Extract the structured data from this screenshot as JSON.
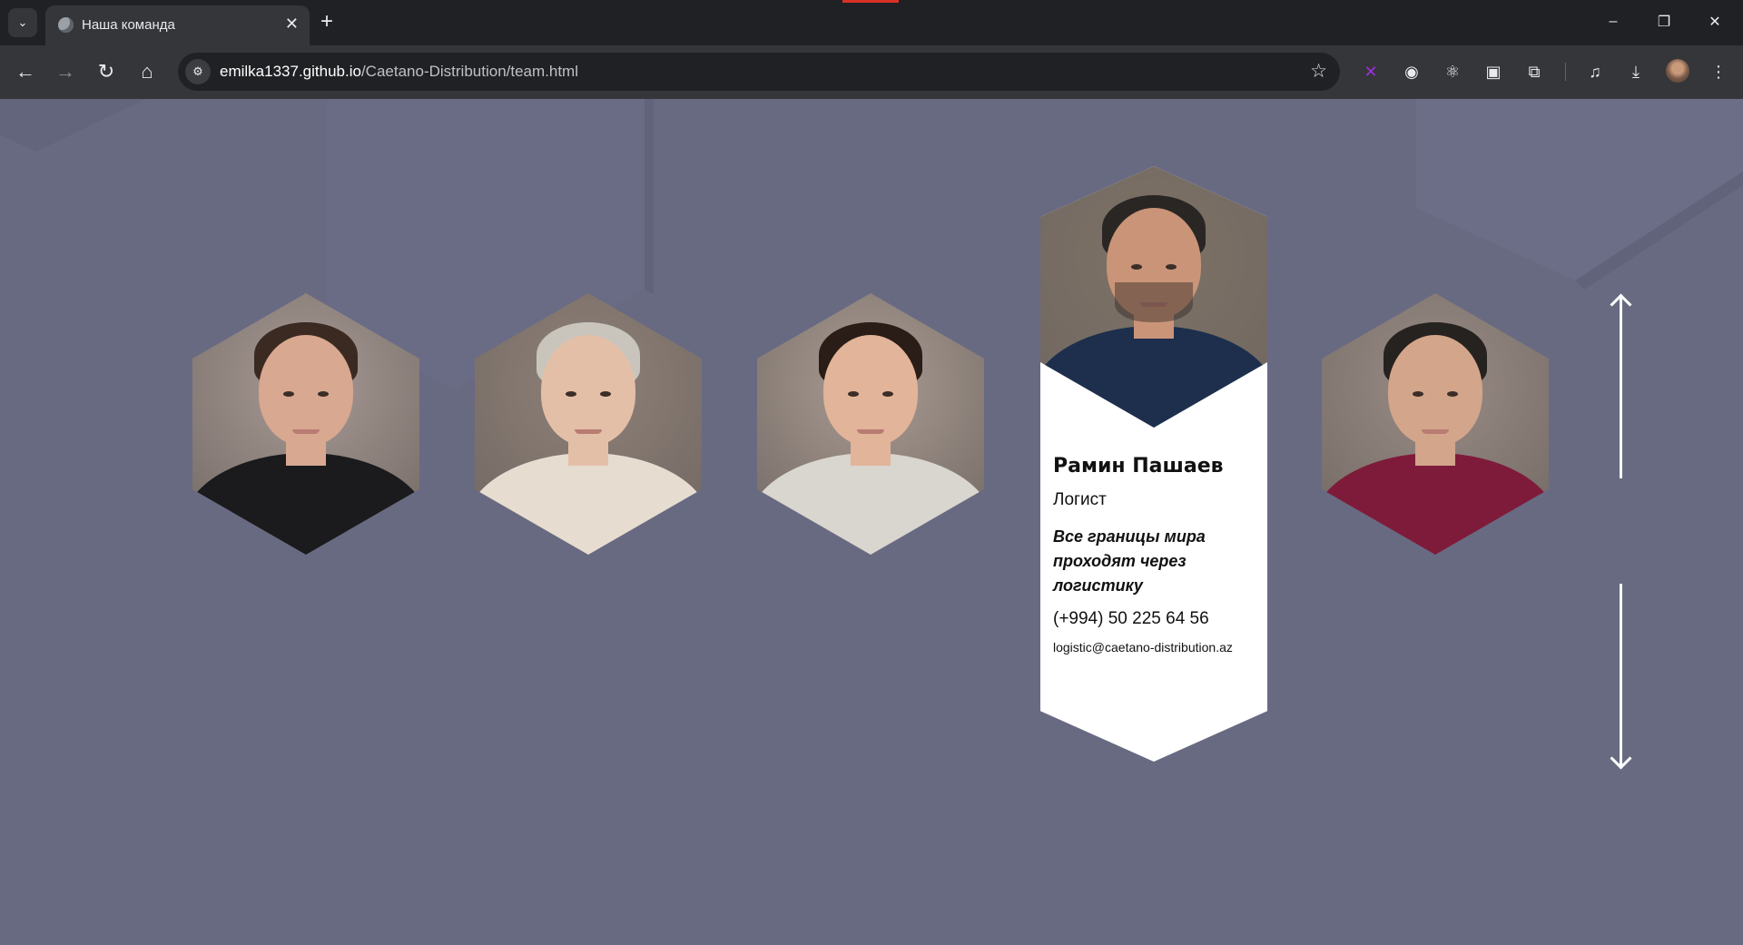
{
  "browser": {
    "tab_title": "Наша команда",
    "tab_close": "✕",
    "new_tab": "+",
    "url_host": "emilka1337.github.io",
    "url_path": "/Caetano-Distribution/team.html",
    "window_controls": {
      "minimize": "–",
      "restore": "❐",
      "close": "✕"
    },
    "nav": {
      "back": "←",
      "forward": "→",
      "reload": "↻",
      "home": "⌂"
    },
    "extensions": [
      "x-extension-icon",
      "owl-extension-icon",
      "react-devtools-icon",
      "picture-in-picture-icon",
      "extensions-puzzle-icon",
      "media-controls-icon",
      "download-icon"
    ]
  },
  "team": {
    "members": [
      {
        "role_hint": "portrait",
        "skin": "#d8a890",
        "hair": "#3a2a22",
        "shirt": "#1b1b1d",
        "bg": "#a89a96"
      },
      {
        "role_hint": "portrait",
        "skin": "#e4bfa8",
        "hair": "#c9c5bc",
        "shirt": "#e6dcd0",
        "bg": "#8e8078"
      },
      {
        "role_hint": "portrait",
        "skin": "#e2b49a",
        "hair": "#2a1c16",
        "shirt": "#d9d5cf",
        "bg": "#a99b93"
      },
      {
        "role_hint": "portrait",
        "skin": "#d3a58a",
        "hair": "#262220",
        "shirt": "#7e1b3b",
        "bg": "#9a8c87"
      }
    ],
    "featured": {
      "name": "Рамин Пашаев",
      "role": "Логист",
      "quote": "Все границы мира проходят через логистику",
      "phone": "(+994) 50 225 64 56",
      "email": "logistic@caetano-distribution.az",
      "skin": "#c99478",
      "hair": "#2a2624",
      "shirt": "#1d2f4d",
      "bg": "#7d7266"
    }
  },
  "colors": {
    "page_bg": "#686a82",
    "card_bg": "#ffffff",
    "arrow": "#ffffff"
  }
}
